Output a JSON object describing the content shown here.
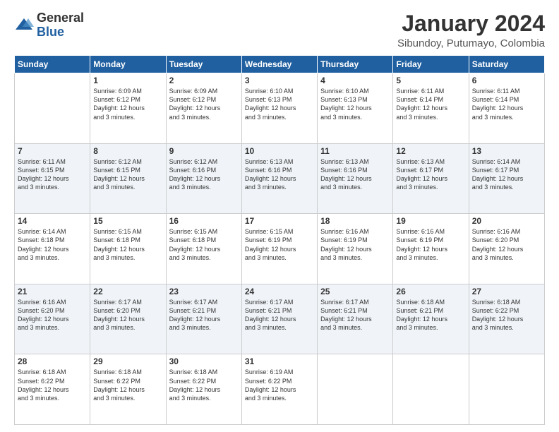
{
  "logo": {
    "general": "General",
    "blue": "Blue"
  },
  "header": {
    "month": "January 2024",
    "location": "Sibundoy, Putumayo, Colombia"
  },
  "weekdays": [
    "Sunday",
    "Monday",
    "Tuesday",
    "Wednesday",
    "Thursday",
    "Friday",
    "Saturday"
  ],
  "weeks": [
    [
      {
        "day": "",
        "info": ""
      },
      {
        "day": "1",
        "info": "Sunrise: 6:09 AM\nSunset: 6:12 PM\nDaylight: 12 hours\nand 3 minutes."
      },
      {
        "day": "2",
        "info": "Sunrise: 6:09 AM\nSunset: 6:12 PM\nDaylight: 12 hours\nand 3 minutes."
      },
      {
        "day": "3",
        "info": "Sunrise: 6:10 AM\nSunset: 6:13 PM\nDaylight: 12 hours\nand 3 minutes."
      },
      {
        "day": "4",
        "info": "Sunrise: 6:10 AM\nSunset: 6:13 PM\nDaylight: 12 hours\nand 3 minutes."
      },
      {
        "day": "5",
        "info": "Sunrise: 6:11 AM\nSunset: 6:14 PM\nDaylight: 12 hours\nand 3 minutes."
      },
      {
        "day": "6",
        "info": "Sunrise: 6:11 AM\nSunset: 6:14 PM\nDaylight: 12 hours\nand 3 minutes."
      }
    ],
    [
      {
        "day": "7",
        "info": "Sunrise: 6:11 AM\nSunset: 6:15 PM\nDaylight: 12 hours\nand 3 minutes."
      },
      {
        "day": "8",
        "info": "Sunrise: 6:12 AM\nSunset: 6:15 PM\nDaylight: 12 hours\nand 3 minutes."
      },
      {
        "day": "9",
        "info": "Sunrise: 6:12 AM\nSunset: 6:16 PM\nDaylight: 12 hours\nand 3 minutes."
      },
      {
        "day": "10",
        "info": "Sunrise: 6:13 AM\nSunset: 6:16 PM\nDaylight: 12 hours\nand 3 minutes."
      },
      {
        "day": "11",
        "info": "Sunrise: 6:13 AM\nSunset: 6:16 PM\nDaylight: 12 hours\nand 3 minutes."
      },
      {
        "day": "12",
        "info": "Sunrise: 6:13 AM\nSunset: 6:17 PM\nDaylight: 12 hours\nand 3 minutes."
      },
      {
        "day": "13",
        "info": "Sunrise: 6:14 AM\nSunset: 6:17 PM\nDaylight: 12 hours\nand 3 minutes."
      }
    ],
    [
      {
        "day": "14",
        "info": "Sunrise: 6:14 AM\nSunset: 6:18 PM\nDaylight: 12 hours\nand 3 minutes."
      },
      {
        "day": "15",
        "info": "Sunrise: 6:15 AM\nSunset: 6:18 PM\nDaylight: 12 hours\nand 3 minutes."
      },
      {
        "day": "16",
        "info": "Sunrise: 6:15 AM\nSunset: 6:18 PM\nDaylight: 12 hours\nand 3 minutes."
      },
      {
        "day": "17",
        "info": "Sunrise: 6:15 AM\nSunset: 6:19 PM\nDaylight: 12 hours\nand 3 minutes."
      },
      {
        "day": "18",
        "info": "Sunrise: 6:16 AM\nSunset: 6:19 PM\nDaylight: 12 hours\nand 3 minutes."
      },
      {
        "day": "19",
        "info": "Sunrise: 6:16 AM\nSunset: 6:19 PM\nDaylight: 12 hours\nand 3 minutes."
      },
      {
        "day": "20",
        "info": "Sunrise: 6:16 AM\nSunset: 6:20 PM\nDaylight: 12 hours\nand 3 minutes."
      }
    ],
    [
      {
        "day": "21",
        "info": "Sunrise: 6:16 AM\nSunset: 6:20 PM\nDaylight: 12 hours\nand 3 minutes."
      },
      {
        "day": "22",
        "info": "Sunrise: 6:17 AM\nSunset: 6:20 PM\nDaylight: 12 hours\nand 3 minutes."
      },
      {
        "day": "23",
        "info": "Sunrise: 6:17 AM\nSunset: 6:21 PM\nDaylight: 12 hours\nand 3 minutes."
      },
      {
        "day": "24",
        "info": "Sunrise: 6:17 AM\nSunset: 6:21 PM\nDaylight: 12 hours\nand 3 minutes."
      },
      {
        "day": "25",
        "info": "Sunrise: 6:17 AM\nSunset: 6:21 PM\nDaylight: 12 hours\nand 3 minutes."
      },
      {
        "day": "26",
        "info": "Sunrise: 6:18 AM\nSunset: 6:21 PM\nDaylight: 12 hours\nand 3 minutes."
      },
      {
        "day": "27",
        "info": "Sunrise: 6:18 AM\nSunset: 6:22 PM\nDaylight: 12 hours\nand 3 minutes."
      }
    ],
    [
      {
        "day": "28",
        "info": "Sunrise: 6:18 AM\nSunset: 6:22 PM\nDaylight: 12 hours\nand 3 minutes."
      },
      {
        "day": "29",
        "info": "Sunrise: 6:18 AM\nSunset: 6:22 PM\nDaylight: 12 hours\nand 3 minutes."
      },
      {
        "day": "30",
        "info": "Sunrise: 6:18 AM\nSunset: 6:22 PM\nDaylight: 12 hours\nand 3 minutes."
      },
      {
        "day": "31",
        "info": "Sunrise: 6:19 AM\nSunset: 6:22 PM\nDaylight: 12 hours\nand 3 minutes."
      },
      {
        "day": "",
        "info": ""
      },
      {
        "day": "",
        "info": ""
      },
      {
        "day": "",
        "info": ""
      }
    ]
  ]
}
